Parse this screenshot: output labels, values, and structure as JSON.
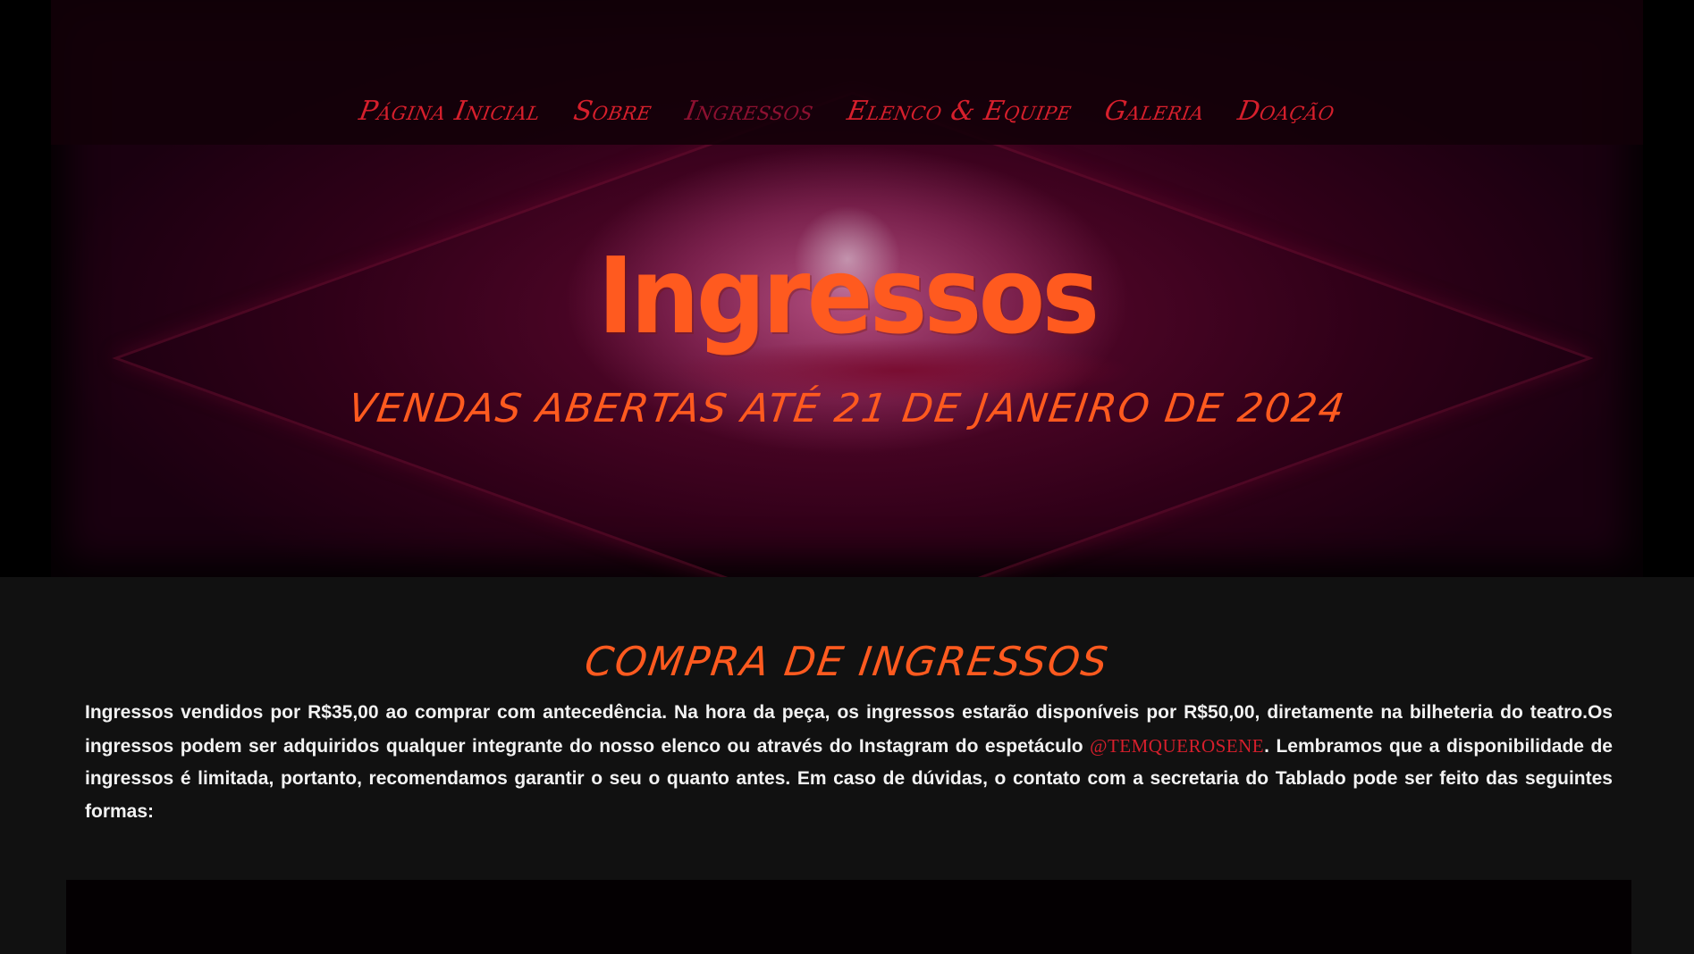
{
  "nav": {
    "items": [
      {
        "label": "Página Inicial",
        "active": false
      },
      {
        "label": "Sobre",
        "active": false
      },
      {
        "label": "Ingressos",
        "active": true
      },
      {
        "label": "Elenco & Equipe",
        "active": false
      },
      {
        "label": "Galeria",
        "active": false
      },
      {
        "label": "Doação",
        "active": false
      }
    ]
  },
  "hero": {
    "title": "Ingressos",
    "subtitle": "VENDAS ABERTAS ATÉ 21 DE JANEIRO DE 2024"
  },
  "section": {
    "title": "COMPRA DE INGRESSOS",
    "text_part1": "Ingressos vendidos por R$35,00 ao comprar com antecedência. Na hora da peça, os ingressos estarão disponíveis por R$50,00, diretamente na bilheteria do teatro.Os ingressos podem ser adquiridos qualquer integrante do nosso elenco ou através do Instagram do espetáculo ",
    "instagram_handle": "@TEMQUEROSENE",
    "text_part2": ". Lembramos que a disponibilidade de ingressos é limitada, portanto, recomendamos garantir o seu o quanto antes. Em caso de dúvidas, o contato com a secretaria do Tablado pode ser feito das seguintes formas:"
  },
  "colors": {
    "accent_orange": "#ff5a1f",
    "nav_red": "#d61f2c",
    "nav_active": "#8c1030",
    "background": "#111111"
  }
}
